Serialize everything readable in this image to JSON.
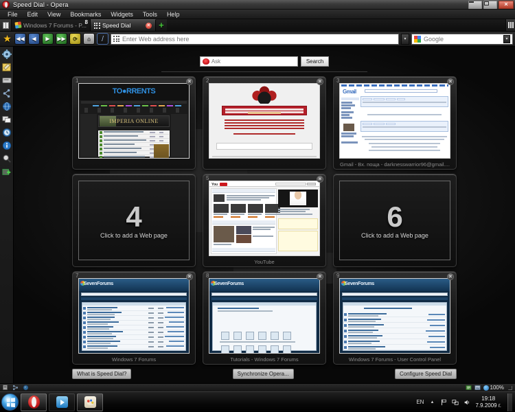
{
  "window": {
    "title": "Speed Dial - Opera",
    "logo_icon": "opera-logo-icon",
    "minimize_label": "–",
    "maximize_label": "□",
    "close_label": "✕"
  },
  "menubar": {
    "items": [
      {
        "label": "File"
      },
      {
        "label": "Edit"
      },
      {
        "label": "View"
      },
      {
        "label": "Bookmarks"
      },
      {
        "label": "Widgets"
      },
      {
        "label": "Tools"
      },
      {
        "label": "Help"
      }
    ]
  },
  "tabbar": {
    "panel_toggle_icon": "panel-toggle-icon",
    "tabs": [
      {
        "label": "Windows 7 Forums - P...",
        "favicon": "windows-flag-icon",
        "badge": "8",
        "active": false
      },
      {
        "label": "Speed Dial",
        "favicon": "speed-dial-grid-icon",
        "active": true,
        "close_label": "✕"
      }
    ],
    "new_tab_label": "+",
    "right_button_icon": "tab-menu-icon"
  },
  "navbar": {
    "bookmark_star_icon": "star-icon",
    "buttons": [
      {
        "name": "rewind-button",
        "icon": "rewind-icon",
        "glyph": "◀◀"
      },
      {
        "name": "back-button",
        "icon": "back-arrow-icon",
        "glyph": "◀"
      },
      {
        "name": "forward-button",
        "icon": "forward-arrow-icon",
        "glyph": "▶"
      },
      {
        "name": "fast-forward-button",
        "icon": "fast-forward-icon",
        "glyph": "▶▶"
      },
      {
        "name": "reload-button",
        "icon": "reload-icon",
        "glyph": "⟳"
      },
      {
        "name": "home-button",
        "icon": "home-icon",
        "glyph": "⌂"
      },
      {
        "name": "stop-button",
        "icon": "slash-icon",
        "glyph": "/"
      }
    ],
    "address": {
      "icon": "speed-dial-grid-icon",
      "value": "",
      "placeholder": "Enter Web address here",
      "dropdown_label": "▾"
    },
    "search": {
      "engine_icon": "google-icon",
      "value": "",
      "placeholder": "Google",
      "dropdown_label": "▾"
    }
  },
  "sidebar": {
    "items": [
      {
        "name": "panel-settings",
        "icon": "gear-icon"
      },
      {
        "name": "notes-panel",
        "icon": "notes-pencil-icon"
      },
      {
        "name": "transfers-panel",
        "icon": "drive-icon"
      },
      {
        "name": "links-panel",
        "icon": "links-icon"
      },
      {
        "name": "widgets-panel",
        "icon": "globe-icon"
      },
      {
        "name": "windows-panel",
        "icon": "windows-stack-icon"
      },
      {
        "name": "history-panel",
        "icon": "history-clock-icon"
      },
      {
        "name": "info-panel",
        "icon": "info-icon"
      },
      {
        "name": "search-panel",
        "icon": "magnifier-icon"
      },
      {
        "name": "add-panel",
        "icon": "add-panel-icon"
      }
    ]
  },
  "speeddial": {
    "ask_search": {
      "icon": "ask-logo-icon",
      "value": "",
      "placeholder": "Ask",
      "button_label": "Search"
    },
    "cells": [
      {
        "number": "1",
        "caption": "",
        "type": "torrents",
        "close_label": "✕",
        "empty": false
      },
      {
        "number": "2",
        "caption": "",
        "type": "redlogin",
        "close_label": "✕",
        "empty": false
      },
      {
        "number": "3",
        "caption": "Gmail - Вх. поща - darknesswarrior96@gmail....",
        "type": "gmail",
        "close_label": "✕",
        "empty": false
      },
      {
        "number": "4",
        "caption": "",
        "type": "empty",
        "empty": true,
        "empty_text": "Click to add a Web page"
      },
      {
        "number": "5",
        "caption": "YouTube",
        "type": "youtube",
        "close_label": "✕",
        "empty": false
      },
      {
        "number": "6",
        "caption": "",
        "type": "empty",
        "empty": true,
        "empty_text": "Click to add a Web page"
      },
      {
        "number": "7",
        "caption": "Windows 7 Forums",
        "type": "sevenforums",
        "close_label": "✕",
        "empty": false
      },
      {
        "number": "8",
        "caption": "Tutorials - Windows 7 Forums",
        "type": "sevenforums2",
        "close_label": "✕",
        "empty": false
      },
      {
        "number": "9",
        "caption": "Windows 7 Forums - User Control Panel",
        "type": "sevenforums3",
        "close_label": "✕",
        "empty": false
      }
    ],
    "buttons": [
      {
        "name": "what-is-speed-dial-button",
        "label": "What is Speed Dial?"
      },
      {
        "name": "synchronize-opera-button",
        "label": "Synchronize Opera..."
      },
      {
        "name": "configure-speed-dial-button",
        "label": "Configure Speed Dial"
      }
    ]
  },
  "statusbar": {
    "icons": [
      "image-toggle-icon",
      "proxy-icon",
      "cookie-icon"
    ],
    "right_icons": [
      "fit-to-width-icon",
      "image-mode-icon"
    ],
    "zoom_label": "100%",
    "zoom_icon": "zoom-person-icon",
    "resize_grip": "resize-grip-icon"
  },
  "taskbar": {
    "start_icon": "windows-start-orb-icon",
    "apps": [
      {
        "name": "taskbar-opera",
        "icon": "opera-icon",
        "active": true
      },
      {
        "name": "taskbar-media-player",
        "icon": "media-player-icon",
        "active": false
      },
      {
        "name": "taskbar-paint",
        "icon": "paint-icon",
        "active": false
      }
    ],
    "tray": {
      "language": "EN",
      "show_hidden_label": "▲",
      "icons": [
        "flag-icon",
        "network-icon",
        "volume-icon"
      ],
      "time": "19:18",
      "date": "7.9.2009 г."
    }
  }
}
